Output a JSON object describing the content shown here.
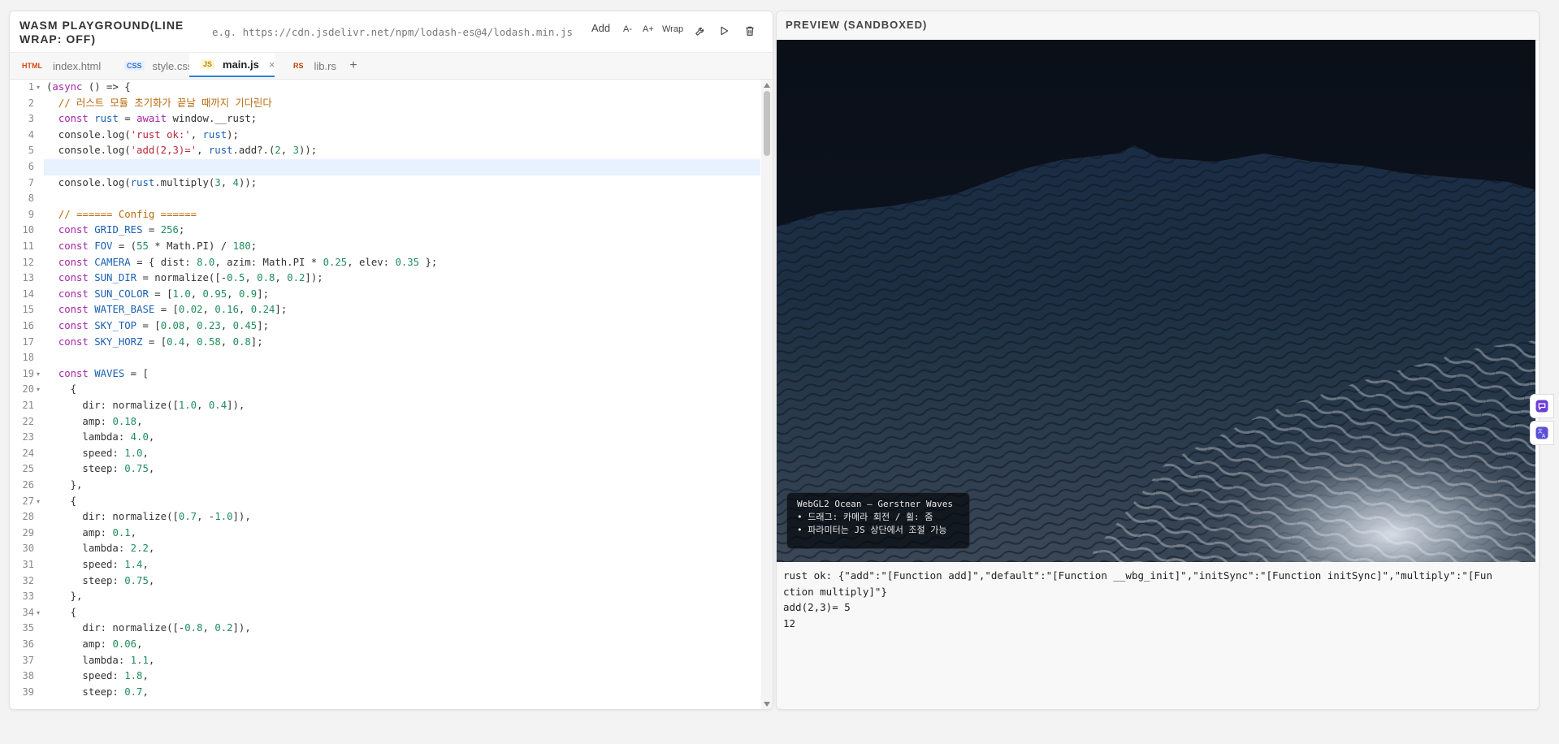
{
  "app": {
    "title": "WASM PLAYGROUND(LINE WRAP: OFF)"
  },
  "toolbar": {
    "url_placeholder": "e.g. https://cdn.jsdelivr.net/npm/lodash-es@4/lodash.min.js",
    "add_label": "Add",
    "font_smaller_label": "A-",
    "font_larger_label": "A+",
    "wrap_label": "Wrap",
    "icons": [
      "wrench-icon",
      "play-icon",
      "trash-icon"
    ]
  },
  "tabs": [
    {
      "badge": "HTML",
      "badge_color": "#d9480f",
      "label": "index.html",
      "active": false
    },
    {
      "badge": "CSS",
      "badge_color": "#2f6fd6",
      "label": "style.css",
      "active": false
    },
    {
      "badge": "JS",
      "badge_color": "#b58900",
      "label": "main.js",
      "active": true,
      "close": "×"
    },
    {
      "badge": "RS",
      "badge_color": "#c2410c",
      "label": "lib.rs",
      "active": false
    }
  ],
  "add_tab_label": "+",
  "editor": {
    "line_numbers": [
      "1",
      "2",
      "3",
      "4",
      "5",
      "6",
      "7",
      "8",
      "9",
      "10",
      "11",
      "12",
      "13",
      "14",
      "15",
      "16",
      "17",
      "18",
      "19",
      "20",
      "21",
      "22",
      "23",
      "24",
      "25",
      "26",
      "27",
      "28",
      "29",
      "30",
      "31",
      "32",
      "33",
      "34",
      "35",
      "36",
      "37",
      "38",
      "39"
    ],
    "fold_lines": [
      "1",
      "19",
      "20",
      "27",
      "34"
    ],
    "highlight_line": "6",
    "lines": [
      "(async () => {",
      "  // 러스트 모듈 초기화가 끝날 때까지 기다린다",
      "  const rust = await window.__rust;",
      "  console.log('rust ok:', rust);",
      "  console.log('add(2,3)=', rust.add?.(2, 3));",
      "",
      "  console.log(rust.multiply(3, 4));",
      "",
      "  // ====== Config ======",
      "  const GRID_RES = 256;",
      "  const FOV = (55 * Math.PI) / 180;",
      "  const CAMERA = { dist: 8.0, azim: Math.PI * 0.25, elev: 0.35 };",
      "  const SUN_DIR = normalize([-0.5, 0.8, 0.2]);",
      "  const SUN_COLOR = [1.0, 0.95, 0.9];",
      "  const WATER_BASE = [0.02, 0.16, 0.24];",
      "  const SKY_TOP = [0.08, 0.23, 0.45];",
      "  const SKY_HORZ = [0.4, 0.58, 0.8];",
      "",
      "  const WAVES = [",
      "    {",
      "      dir: normalize([1.0, 0.4]),",
      "      amp: 0.18,",
      "      lambda: 4.0,",
      "      speed: 1.0,",
      "      steep: 0.75,",
      "    },",
      "    {",
      "      dir: normalize([0.7, -1.0]),",
      "      amp: 0.1,",
      "      lambda: 2.2,",
      "      speed: 1.4,",
      "      steep: 0.75,",
      "    },",
      "    {",
      "      dir: normalize([-0.8, 0.2]),",
      "      amp: 0.06,",
      "      lambda: 1.1,",
      "      speed: 1.8,",
      "      steep: 0.7,"
    ]
  },
  "preview": {
    "title": "PREVIEW (SANDBOXED)",
    "overlay": {
      "line1": "WebGL2 Ocean — Gerstner Waves",
      "line2": "• 드래그: 카메라 회전 / 휠: 줌",
      "line3": "• 파라미터는 JS 상단에서 조절 가능"
    }
  },
  "console": {
    "lines": [
      "rust ok: {\"add\":\"[Function add]\",\"default\":\"[Function __wbg_init]\",\"initSync\":\"[Function initSync]\",\"multiply\":\"[Function multiply]\"}",
      "add(2,3)= 5",
      "12"
    ]
  },
  "floating": {
    "icons": [
      "chat-assistant-icon",
      "translate-icon"
    ],
    "accent": "#6b3fd6"
  },
  "colors": {
    "accent": "#2f80d9",
    "ocean_dark": "#0b1018"
  }
}
